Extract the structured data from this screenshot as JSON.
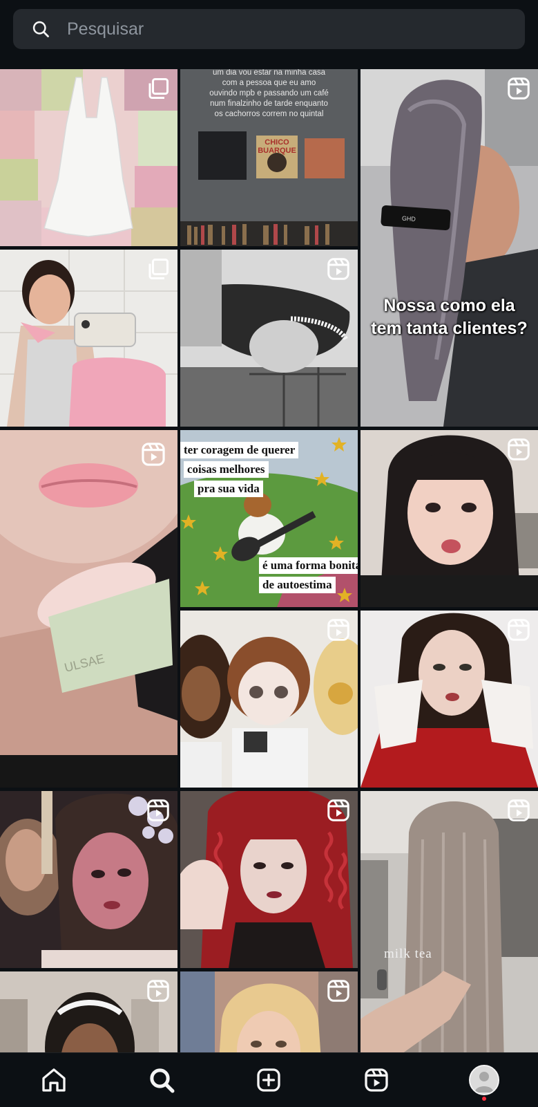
{
  "search": {
    "placeholder": "Pesquisar",
    "value": ""
  },
  "tiles": [
    {
      "type": "carousel"
    },
    {
      "type": "photo",
      "caption": "um dia vou estar na minha casa com a pessoa que eu amo ouvindo mpb e passando um café num finalzinho de tarde enquanto os cachorros correm no quintal",
      "album_text": "CHICO BUARQUE"
    },
    {
      "type": "reel",
      "overlay_text": "Nossa como ela tem tanta clientes?"
    },
    {
      "type": "carousel"
    },
    {
      "type": "reel"
    },
    {
      "type": "reel"
    },
    {
      "type": "photo",
      "meme_lines": [
        "ter coragem de querer",
        "coisas melhores",
        "pra sua vida",
        "é uma forma bonita",
        "de autoestima"
      ]
    },
    {
      "type": "reel"
    },
    {
      "type": "reel"
    },
    {
      "type": "reel"
    },
    {
      "type": "reel"
    },
    {
      "type": "reel"
    },
    {
      "type": "reel",
      "overlay_text": "milk tea"
    },
    {
      "type": "reel"
    },
    {
      "type": "reel"
    }
  ],
  "nav": [
    {
      "icon": "home-icon"
    },
    {
      "icon": "search-icon",
      "active": true
    },
    {
      "icon": "create-icon"
    },
    {
      "icon": "reels-icon"
    },
    {
      "icon": "profile-avatar",
      "notification": true
    }
  ],
  "colors": {
    "background": "#0c1014",
    "search_field": "#25292e",
    "notification_dot": "#ff3040"
  }
}
